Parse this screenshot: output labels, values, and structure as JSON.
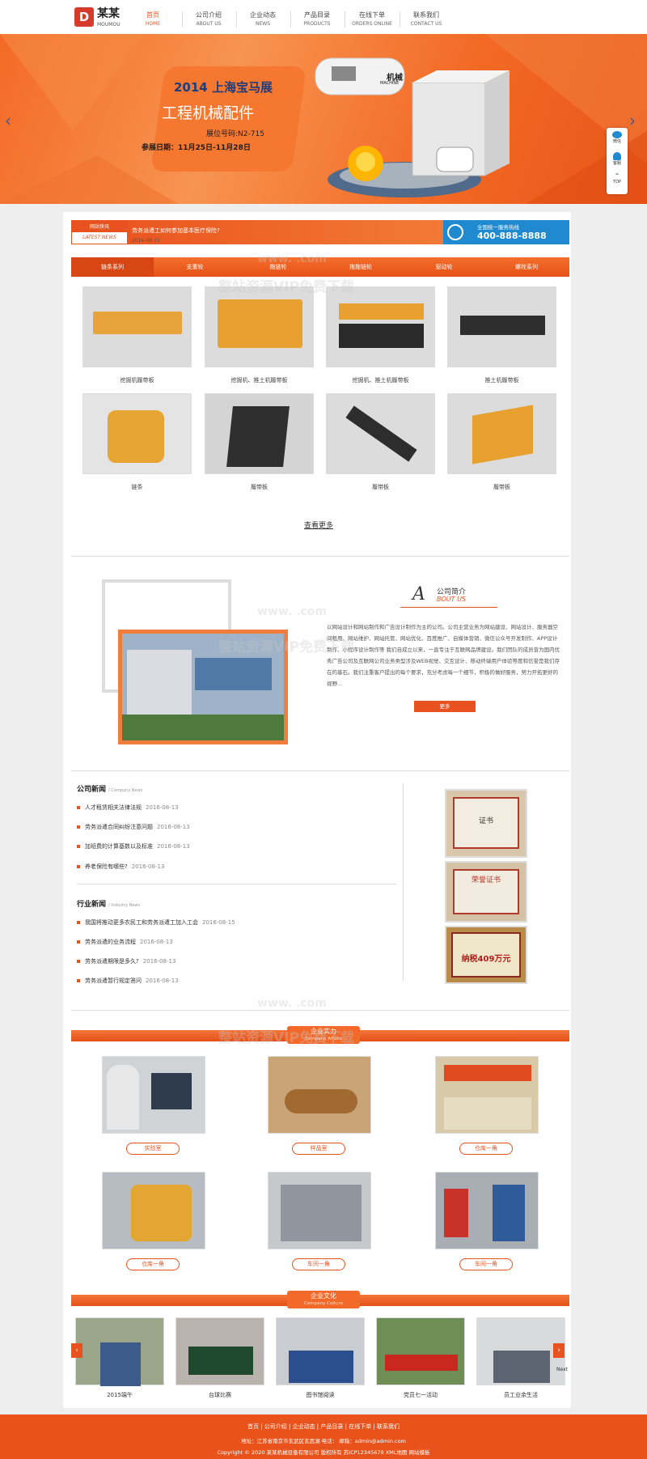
{
  "header": {
    "logo_letter": "D",
    "logo_name": "某某",
    "logo_sub": "MOUMOU",
    "nav": [
      {
        "zh": "首页",
        "en": "HOME"
      },
      {
        "zh": "公司介绍",
        "en": "ABOUT US"
      },
      {
        "zh": "企业动态",
        "en": "NEWS"
      },
      {
        "zh": "产品目录",
        "en": "PRODUCTS"
      },
      {
        "zh": "在线下单",
        "en": "ORDERS ONLINE"
      },
      {
        "zh": "联系我们",
        "en": "CONTACT US"
      }
    ]
  },
  "banner": {
    "line1": "2014 上海宝马展",
    "line2": "工程机械配件",
    "line3": "展位号码:N2-715",
    "line4": "参展日期：11月25日-11月28日",
    "booth_sign": "机械",
    "booth_sign_en": "MACHINE"
  },
  "side_tools": [
    "微信",
    "客服",
    "TOP"
  ],
  "newsbar": {
    "label_zh": "网站快讯",
    "label_en": "LATEST NEWS",
    "headline": "劳务派遣工如何参加基本医疗保险?",
    "date": "2016-08-15",
    "hotline_label": "全国统一服务热线",
    "hotline": "400-888-8888"
  },
  "categories": [
    "链条系列",
    "支重轮",
    "拖链轮",
    "拖拖链轮",
    "驱动轮",
    "螺栓系列"
  ],
  "products": [
    {
      "label": "挖掘机履带板"
    },
    {
      "label": "挖掘机、推土机履带板"
    },
    {
      "label": "挖掘机、推土机履带板"
    },
    {
      "label": "推土机履带板"
    },
    {
      "label": "链条"
    },
    {
      "label": "履带板"
    },
    {
      "label": "履带板"
    },
    {
      "label": "履带板"
    }
  ],
  "more_link": "查看更多",
  "about": {
    "letter": "A",
    "title": "公司简介",
    "subtitle": "BOUT US",
    "text": "以网站设计和网站制作和广告设计制作为主的公司。公司主营业务为网站建设、网站设计、服务器空间租用、网站维护、网站托管、网站优化、百度推广、自媒体营销、微信公众号开发制作、APP设计制作、小程序设计制作等 我们自成立以来，一直专注于互联网品牌建设。我们团队的成员曾为国内优秀广告公司及互联网公司业务类型涉及WEB视觉、交互设计、移动终端用户体验等度和信誉是我们存在的基石。我们注重客户提出的每个要求，充分考虑每一个细节，积极的做好服务，努力开拓更好的视野...",
    "more": "更多"
  },
  "company_news": {
    "title": "公司新闻",
    "subtitle": "/ Company News",
    "items": [
      {
        "text": "人才租赁相关法律法规",
        "date": "2016-08-13"
      },
      {
        "text": "劳务派遣合同纠纷注意问题",
        "date": "2016-08-13"
      },
      {
        "text": "加班费的计算基数以及标准",
        "date": "2016-08-13"
      },
      {
        "text": "养老保险有哪些?",
        "date": "2016-08-13"
      }
    ]
  },
  "industry_news": {
    "title": "行业新闻",
    "subtitle": "/ Industry News",
    "items": [
      {
        "text": "我国将推动更多农民工和劳务派遣工加入工会",
        "date": "2016-08-15"
      },
      {
        "text": "劳务派遣的业务流程",
        "date": "2016-08-13"
      },
      {
        "text": "劳务派遣期限是多久?",
        "date": "2016-08-13"
      },
      {
        "text": "劳务派遣暂行规定答问",
        "date": "2016-08-13"
      }
    ]
  },
  "certificates": {
    "cert1_title": "证书",
    "cert2_title": "荣誉证书",
    "cert3_text": "纳税409万元"
  },
  "strength": {
    "title": "企业实力",
    "subtitle": "Company Affairs",
    "items": [
      "实验室",
      "样品室",
      "仓库一角",
      "仓库一角",
      "车间一角",
      "车间一角"
    ]
  },
  "culture": {
    "title": "企业文化",
    "subtitle": "Company Culture",
    "items": [
      "2015端午",
      "台球比赛",
      "图书馆阅读",
      "党员七一活动",
      "员工业余生活"
    ],
    "next": "Next"
  },
  "footer": {
    "links": "首页 | 公司介绍 | 企业动态 | 产品目录 | 在线下单 | 联系我们",
    "info": "地址：江苏省南京市玄武区玄武湖 电话：  邮箱：admin@admin.com",
    "copyright": "Copyright © 2020 某某机械设备有限公司 版权所有 苏ICP12345678  XML地图  网站模板"
  },
  "watermark": {
    "url": "www.  .com",
    "text": "整站资源VIP免费下载"
  },
  "colors": {
    "accent": "#e8521f",
    "hotline_bg": "#1f8ad0",
    "banner_text_blue": "#1f3c7b"
  }
}
